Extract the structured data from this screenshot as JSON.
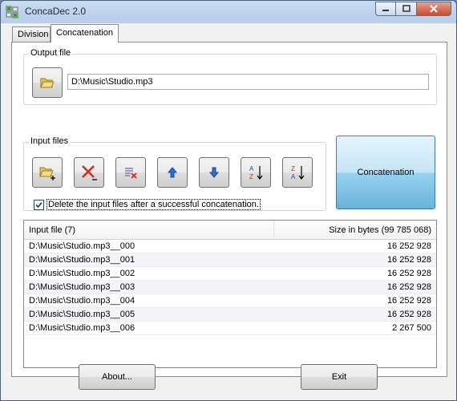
{
  "window": {
    "title": "ConcaDec 2.0"
  },
  "tabs": [
    {
      "label": "Division"
    },
    {
      "label": "Concatenation"
    }
  ],
  "output": {
    "group_label": "Output file",
    "path": "D:\\Music\\Studio.mp3"
  },
  "input": {
    "group_label": "Input files",
    "delete_label": "Delete the input files after a successful concatenation."
  },
  "concat_button": "Concatenation",
  "table": {
    "headers": [
      "Input file (7)",
      "Size in bytes (99 785 068)"
    ],
    "rows": [
      {
        "file": "D:\\Music\\Studio.mp3__000",
        "size": "16 252 928"
      },
      {
        "file": "D:\\Music\\Studio.mp3__001",
        "size": "16 252 928"
      },
      {
        "file": "D:\\Music\\Studio.mp3__002",
        "size": "16 252 928"
      },
      {
        "file": "D:\\Music\\Studio.mp3__003",
        "size": "16 252 928"
      },
      {
        "file": "D:\\Music\\Studio.mp3__004",
        "size": "16 252 928"
      },
      {
        "file": "D:\\Music\\Studio.mp3__005",
        "size": "16 252 928"
      },
      {
        "file": "D:\\Music\\Studio.mp3__006",
        "size": "2 267 500"
      }
    ]
  },
  "buttons": {
    "about": "About...",
    "exit": "Exit"
  },
  "colors": {
    "accent": "#68b3db",
    "delete_red": "#d22c1e",
    "arrow_blue": "#2b6fd6"
  }
}
